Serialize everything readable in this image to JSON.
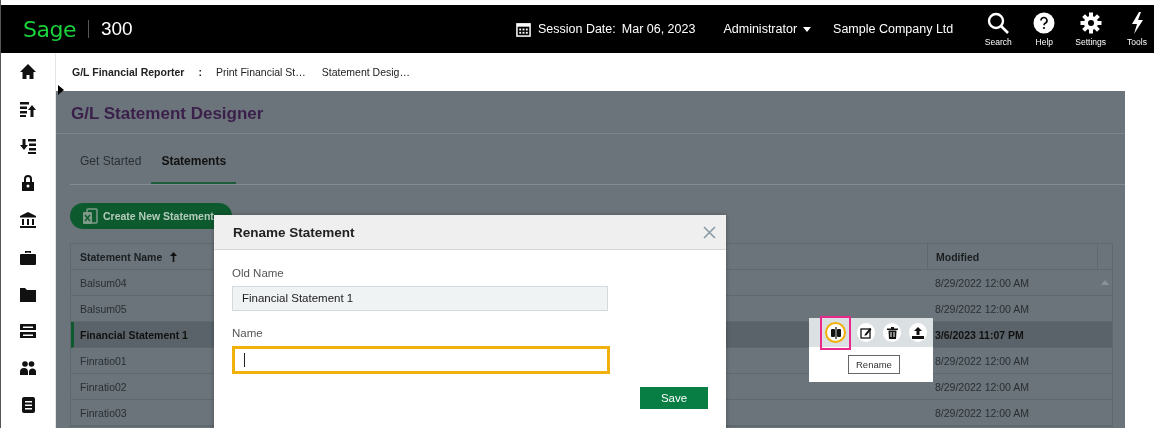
{
  "header": {
    "logo": "Sage",
    "product": "300",
    "session_label": "Session Date:",
    "session_date": "Mar 06, 2023",
    "user": "Administrator",
    "company": "Sample Company Ltd",
    "tools": [
      {
        "kind": "search",
        "label": "Search"
      },
      {
        "kind": "help",
        "label": "Help"
      },
      {
        "kind": "settings",
        "label": "Settings"
      },
      {
        "kind": "tools",
        "label": "Tools"
      }
    ]
  },
  "breadcrumbs": [
    {
      "kind": "root",
      "text": "G/L Financial Reporter"
    },
    {
      "kind": "separator",
      "text": ":"
    },
    {
      "kind": "link",
      "text": "Print Financial St…"
    },
    {
      "kind": "link",
      "text": "Statement Desig…"
    }
  ],
  "page_title": "G/L Statement Designer",
  "tabs": [
    {
      "label": "Get Started",
      "selected": false
    },
    {
      "label": "Statements",
      "selected": true
    }
  ],
  "create_button": "Create New Statement",
  "table": {
    "columns": [
      {
        "label": "Statement Name",
        "sorted": true
      },
      {
        "label": "Modified",
        "sorted": false
      }
    ],
    "rows": [
      {
        "name": "Balsum04",
        "modified": "8/29/2022 12:00 AM",
        "selected": false
      },
      {
        "name": "Balsum05",
        "modified": "8/29/2022 12:00 AM",
        "selected": false
      },
      {
        "name": "Financial Statement 1",
        "modified": "3/6/2023 11:07 PM",
        "selected": true
      },
      {
        "name": "Finratio01",
        "modified": "8/29/2022 12:00 AM",
        "selected": false
      },
      {
        "name": "Finratio02",
        "modified": "8/29/2022 12:00 AM",
        "selected": false
      },
      {
        "name": "Finratio03",
        "modified": "8/29/2022 12:00 AM",
        "selected": false
      }
    ]
  },
  "row_actions": [
    {
      "kind": "rename",
      "highlighted": true
    },
    {
      "kind": "edit",
      "highlighted": false
    },
    {
      "kind": "delete",
      "highlighted": false
    },
    {
      "kind": "upload",
      "highlighted": false
    }
  ],
  "tooltip": "Rename",
  "dialog": {
    "title": "Rename Statement",
    "old_name_label": "Old Name",
    "old_name_value": "Financial Statement 1",
    "name_label": "Name",
    "name_focused": true,
    "save_button": "Save"
  }
}
